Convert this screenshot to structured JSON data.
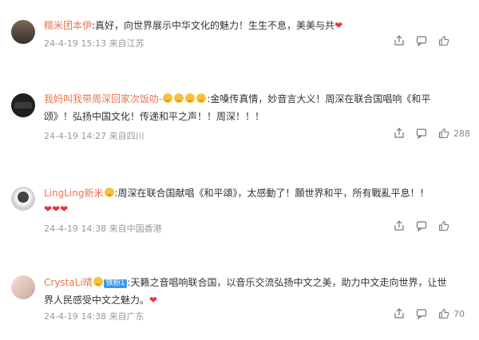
{
  "comments": [
    {
      "username": "糯米团本伊",
      "text1": ":真好，向世界展示中华文化的魅力！生生不息，美美与共",
      "hearts1": 1,
      "date": "24-4-19",
      "time": "15:13",
      "location": "来自江苏",
      "likes": ""
    },
    {
      "username": "我妈叫我带周深回家次饭叻-",
      "text1": ":金嗓传真情，妙音言大义！周深在联合国唱响《和平",
      "text2": "颂》！弘扬中国文化！传递和平之声！！周深！！！",
      "date": "24-4-19",
      "time": "14:27",
      "location": "来自四川",
      "likes": "288"
    },
    {
      "username": "LingLing新米",
      "text1": ":周深在联合国献唱《和平頌》，太感動了！願世界和平，所有戰亂平息！！",
      "hearts2": 3,
      "date": "24-4-19",
      "time": "14:38",
      "location": "来自中国香港",
      "likes": ""
    },
    {
      "username": "CrystaLi晴",
      "badge": "铁粉1",
      "text1": ":天籁之音唱响联合国，以音乐交流弘扬中文之美，助力中文走向世界，让世",
      "text2": "界人民感受中文之魅力。",
      "hearts2": 1,
      "date": "24-4-19",
      "time": "14:38",
      "location": "来自广东",
      "likes": "70"
    }
  ],
  "icons": {
    "share": "share-icon",
    "comment": "comment-icon",
    "like": "like-icon",
    "heart": "heart-emoji"
  }
}
